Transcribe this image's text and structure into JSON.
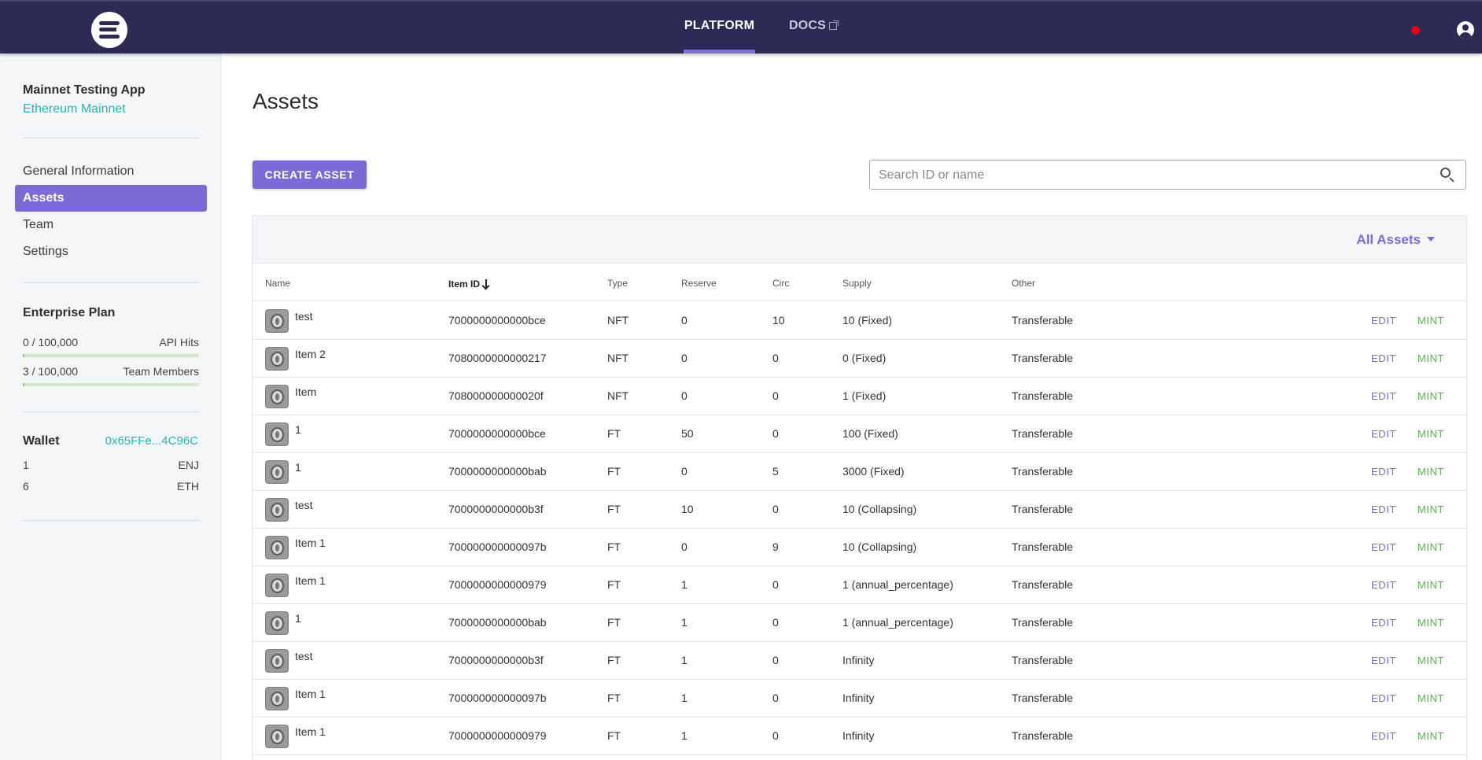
{
  "topbar": {
    "tabs": [
      {
        "label": "PLATFORM",
        "active": true
      },
      {
        "label": "DOCS",
        "external": true
      }
    ],
    "notification_color": "#e3001b"
  },
  "sidebar": {
    "app_name": "Mainnet Testing App",
    "network": "Ethereum Mainnet",
    "items": [
      {
        "label": "General Information",
        "active": false
      },
      {
        "label": "Assets",
        "active": true
      },
      {
        "label": "Team",
        "active": false
      },
      {
        "label": "Settings",
        "active": false
      }
    ],
    "plan": {
      "title": "Enterprise Plan",
      "usage": [
        {
          "count": "0 / 100,000",
          "label": "API Hits",
          "fraction": 0.0
        },
        {
          "count": "3 / 100,000",
          "label": "Team Members",
          "fraction": 3e-05
        }
      ]
    },
    "wallet": {
      "label": "Wallet",
      "address": "0x65FFe...4C96C",
      "balances": [
        {
          "amount": "1",
          "currency": "ENJ"
        },
        {
          "amount": "6",
          "currency": "ETH"
        }
      ]
    }
  },
  "main": {
    "title": "Assets",
    "create_button": "CREATE ASSET",
    "search_placeholder": "Search ID or name",
    "filter": "All Assets",
    "columns": [
      "Name",
      "Item ID",
      "Type",
      "Reserve",
      "Circ",
      "Supply",
      "Other"
    ],
    "sorted_column": "Item ID",
    "rows": [
      {
        "name": "test",
        "item_id": "7000000000000bce",
        "type": "NFT",
        "reserve": "0",
        "circ": "10",
        "supply": "10 (Fixed)",
        "other": "Transferable"
      },
      {
        "name": "Item 2",
        "item_id": "7080000000000217",
        "type": "NFT",
        "reserve": "0",
        "circ": "0",
        "supply": "0 (Fixed)",
        "other": "Transferable"
      },
      {
        "name": "Item",
        "item_id": "708000000000020f",
        "type": "NFT",
        "reserve": "0",
        "circ": "0",
        "supply": "1 (Fixed)",
        "other": "Transferable"
      },
      {
        "name": "1",
        "item_id": "7000000000000bce",
        "type": "FT",
        "reserve": "50",
        "circ": "0",
        "supply": "100 (Fixed)",
        "other": "Transferable"
      },
      {
        "name": "1",
        "item_id": "7000000000000bab",
        "type": "FT",
        "reserve": "0",
        "circ": "5",
        "supply": "3000 (Fixed)",
        "other": "Transferable"
      },
      {
        "name": "test",
        "item_id": "7000000000000b3f",
        "type": "FT",
        "reserve": "10",
        "circ": "0",
        "supply": "10 (Collapsing)",
        "other": "Transferable"
      },
      {
        "name": "Item 1",
        "item_id": "700000000000097b",
        "type": "FT",
        "reserve": "0",
        "circ": "9",
        "supply": "10 (Collapsing)",
        "other": "Transferable"
      },
      {
        "name": "Item 1",
        "item_id": "7000000000000979",
        "type": "FT",
        "reserve": "1",
        "circ": "0",
        "supply": "1 (annual_percentage)",
        "other": "Transferable"
      },
      {
        "name": "1",
        "item_id": "7000000000000bab",
        "type": "FT",
        "reserve": "1",
        "circ": "0",
        "supply": "1 (annual_percentage)",
        "other": "Transferable"
      },
      {
        "name": "test",
        "item_id": "7000000000000b3f",
        "type": "FT",
        "reserve": "1",
        "circ": "0",
        "supply": "Infinity",
        "other": "Transferable"
      },
      {
        "name": "Item 1",
        "item_id": "700000000000097b",
        "type": "FT",
        "reserve": "1",
        "circ": "0",
        "supply": "Infinity",
        "other": "Transferable"
      },
      {
        "name": "Item 1",
        "item_id": "7000000000000979",
        "type": "FT",
        "reserve": "1",
        "circ": "0",
        "supply": "Infinity",
        "other": "Transferable"
      }
    ],
    "row_actions": {
      "edit": "EDIT",
      "mint": "MINT"
    }
  },
  "colors": {
    "topbar": "#2c2b55",
    "accent": "#7e6ad7",
    "teal": "#2ab3b0",
    "mint": "#59b14b"
  }
}
